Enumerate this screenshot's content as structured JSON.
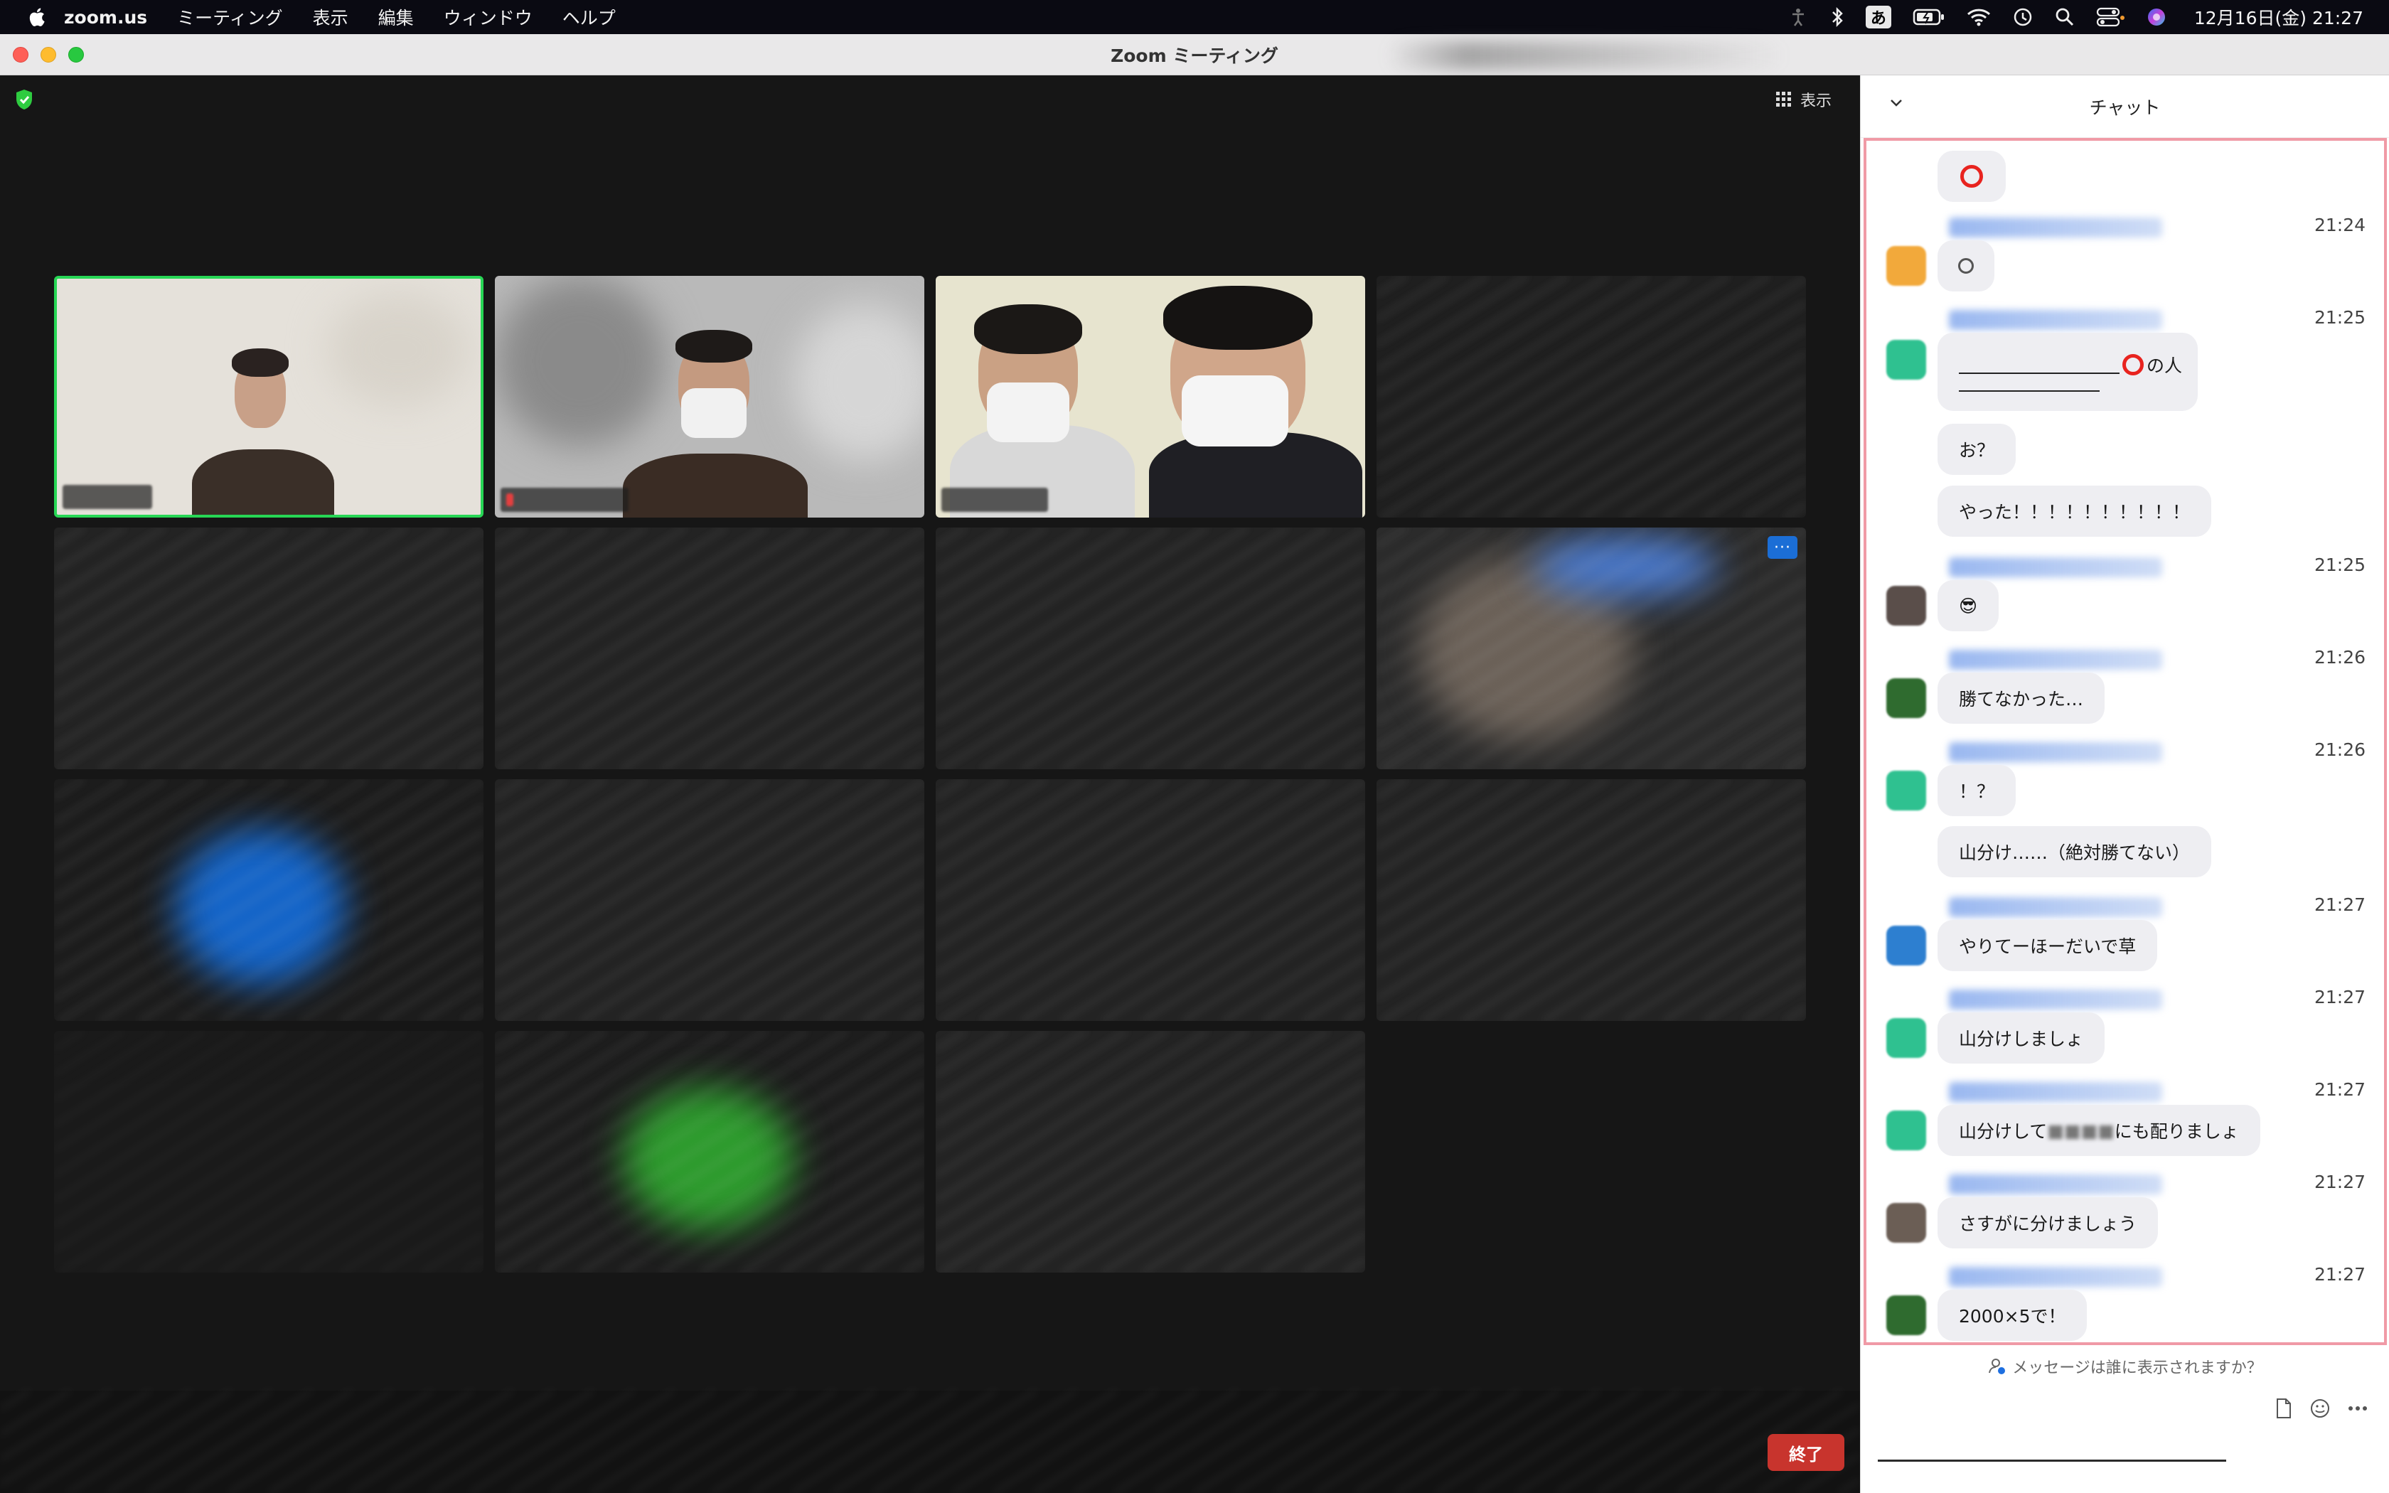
{
  "menubar": {
    "app_name": "zoom.us",
    "menus": [
      "ミーティング",
      "表示",
      "編集",
      "ウィンドウ",
      "ヘルプ"
    ],
    "input_mode": "あ",
    "clock": "12月16日(金) 21:27"
  },
  "window": {
    "title": "Zoom ミーティング"
  },
  "meeting": {
    "view_label": "表示",
    "end_label": "終了",
    "more_label": "···"
  },
  "chat": {
    "title": "チャット",
    "messages": [
      {
        "time": "",
        "text": ""
      },
      {
        "time": "21:24",
        "text": ""
      },
      {
        "time": "21:25",
        "text": "の人"
      },
      {
        "time": "",
        "text": "お？"
      },
      {
        "time": "",
        "text": "やった！！！！！！！！！！"
      },
      {
        "time": "21:25",
        "text": "😎"
      },
      {
        "time": "21:26",
        "text": "勝てなかった…"
      },
      {
        "time": "21:26",
        "text": "！？"
      },
      {
        "time": "",
        "text": "山分け……（絶対勝てない）"
      },
      {
        "time": "21:27",
        "text": "やりてーほーだいで草"
      },
      {
        "time": "21:27",
        "text": "山分けしましょ"
      },
      {
        "time": "21:27",
        "text_before": "山分けして",
        "text_after": "にも配りましょ"
      },
      {
        "time": "21:27",
        "text": "さすがに分けましょう"
      },
      {
        "time": "21:27",
        "text": "2000×5で！"
      }
    ],
    "visibility_prompt": "メッセージは誰に表示されますか？"
  }
}
